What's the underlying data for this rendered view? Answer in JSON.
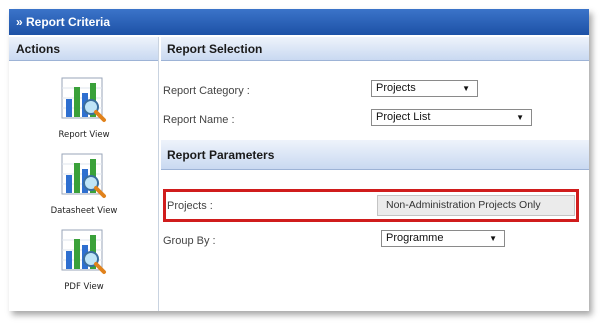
{
  "window": {
    "title": "» Report Criteria"
  },
  "actions": {
    "header": "Actions",
    "items": [
      {
        "label": "Report View",
        "icon": "bar-chart-magnifier-icon"
      },
      {
        "label": "Datasheet View",
        "icon": "bar-chart-magnifier-icon"
      },
      {
        "label": "PDF View",
        "icon": "bar-chart-magnifier-icon"
      }
    ]
  },
  "report_selection": {
    "header": "Report Selection",
    "category": {
      "label": "Report Category :",
      "value": "Projects"
    },
    "name": {
      "label": "Report Name :",
      "value": "Project List"
    }
  },
  "report_parameters": {
    "header": "Report Parameters",
    "projects": {
      "label": "Projects :",
      "value": "Non-Administration Projects Only"
    },
    "group_by": {
      "label": "Group By :",
      "value": "Programme"
    }
  },
  "colors": {
    "titlebar": "#1d51a6",
    "panel_header": "#c9d9f1",
    "highlight": "#d01c1c"
  }
}
